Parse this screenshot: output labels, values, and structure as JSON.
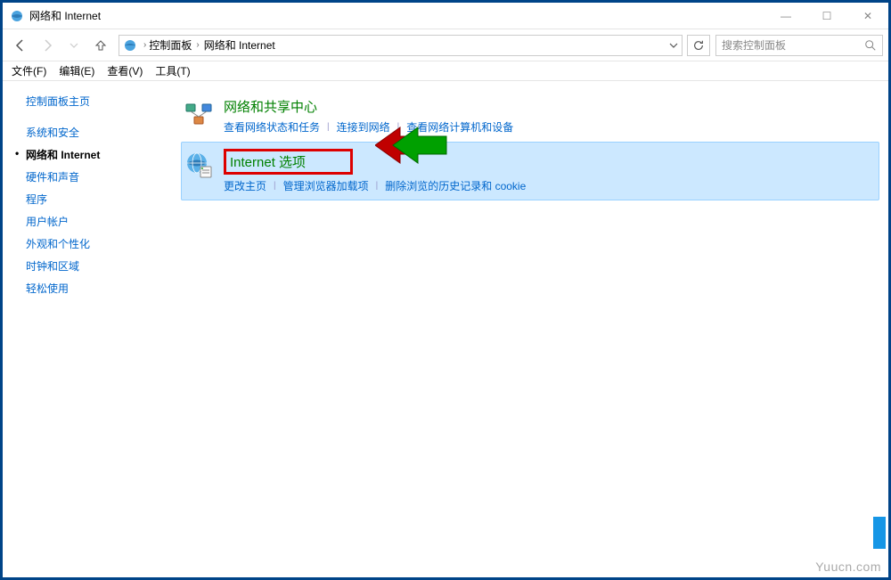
{
  "window": {
    "title": "网络和 Internet"
  },
  "titlebar_controls": {
    "min": "—",
    "max": "☐",
    "close": "✕"
  },
  "breadcrumb": {
    "items": [
      "控制面板",
      "网络和 Internet"
    ]
  },
  "search": {
    "placeholder": "搜索控制面板"
  },
  "menu": {
    "file": "文件(F)",
    "edit": "编辑(E)",
    "view": "查看(V)",
    "tools": "工具(T)"
  },
  "sidebar": {
    "home": "控制面板主页",
    "items": [
      {
        "label": "系统和安全",
        "active": false
      },
      {
        "label": "网络和 Internet",
        "active": true
      },
      {
        "label": "硬件和声音",
        "active": false
      },
      {
        "label": "程序",
        "active": false
      },
      {
        "label": "用户帐户",
        "active": false
      },
      {
        "label": "外观和个性化",
        "active": false
      },
      {
        "label": "时钟和区域",
        "active": false
      },
      {
        "label": "轻松使用",
        "active": false
      }
    ]
  },
  "categories": [
    {
      "icon": "network-sharing-icon",
      "title": "网络和共享中心",
      "highlighted": false,
      "boxed": false,
      "links": [
        "查看网络状态和任务",
        "连接到网络",
        "查看网络计算机和设备"
      ]
    },
    {
      "icon": "internet-options-icon",
      "title": "Internet 选项",
      "highlighted": true,
      "boxed": true,
      "links": [
        "更改主页",
        "管理浏览器加载项",
        "删除浏览的历史记录和 cookie"
      ]
    }
  ],
  "watermark": "Yuucn.com"
}
